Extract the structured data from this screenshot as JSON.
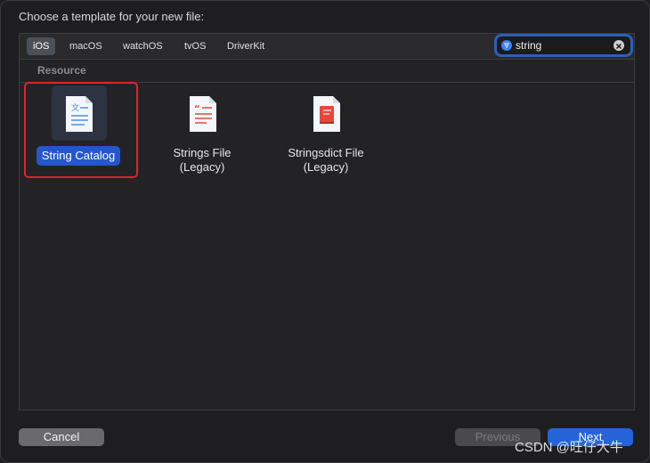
{
  "dialog": {
    "title": "Choose a template for your new file:"
  },
  "platform_tabs": [
    {
      "label": "iOS",
      "selected": true
    },
    {
      "label": "macOS",
      "selected": false
    },
    {
      "label": "watchOS",
      "selected": false
    },
    {
      "label": "tvOS",
      "selected": false
    },
    {
      "label": "DriverKit",
      "selected": false
    }
  ],
  "search": {
    "value": "string",
    "icon": "filter-icon",
    "clear_icon": "clear-icon"
  },
  "section": {
    "label": "Resource"
  },
  "templates": [
    {
      "line1": "String Catalog",
      "line2": "",
      "icon": "string-catalog-icon",
      "selected": true,
      "accent": "#4a90e2"
    },
    {
      "line1": "Strings File",
      "line2": "(Legacy)",
      "icon": "strings-file-icon",
      "selected": false,
      "accent": "#e5483a"
    },
    {
      "line1": "Stringsdict File",
      "line2": "(Legacy)",
      "icon": "stringsdict-file-icon",
      "selected": false,
      "accent": "#e5483a"
    }
  ],
  "buttons": {
    "cancel": "Cancel",
    "previous": "Previous",
    "next": "Next"
  },
  "watermark": "CSDN @旺仔大牛",
  "colors": {
    "accent": "#2563d8",
    "highlight": "#e5202a"
  }
}
